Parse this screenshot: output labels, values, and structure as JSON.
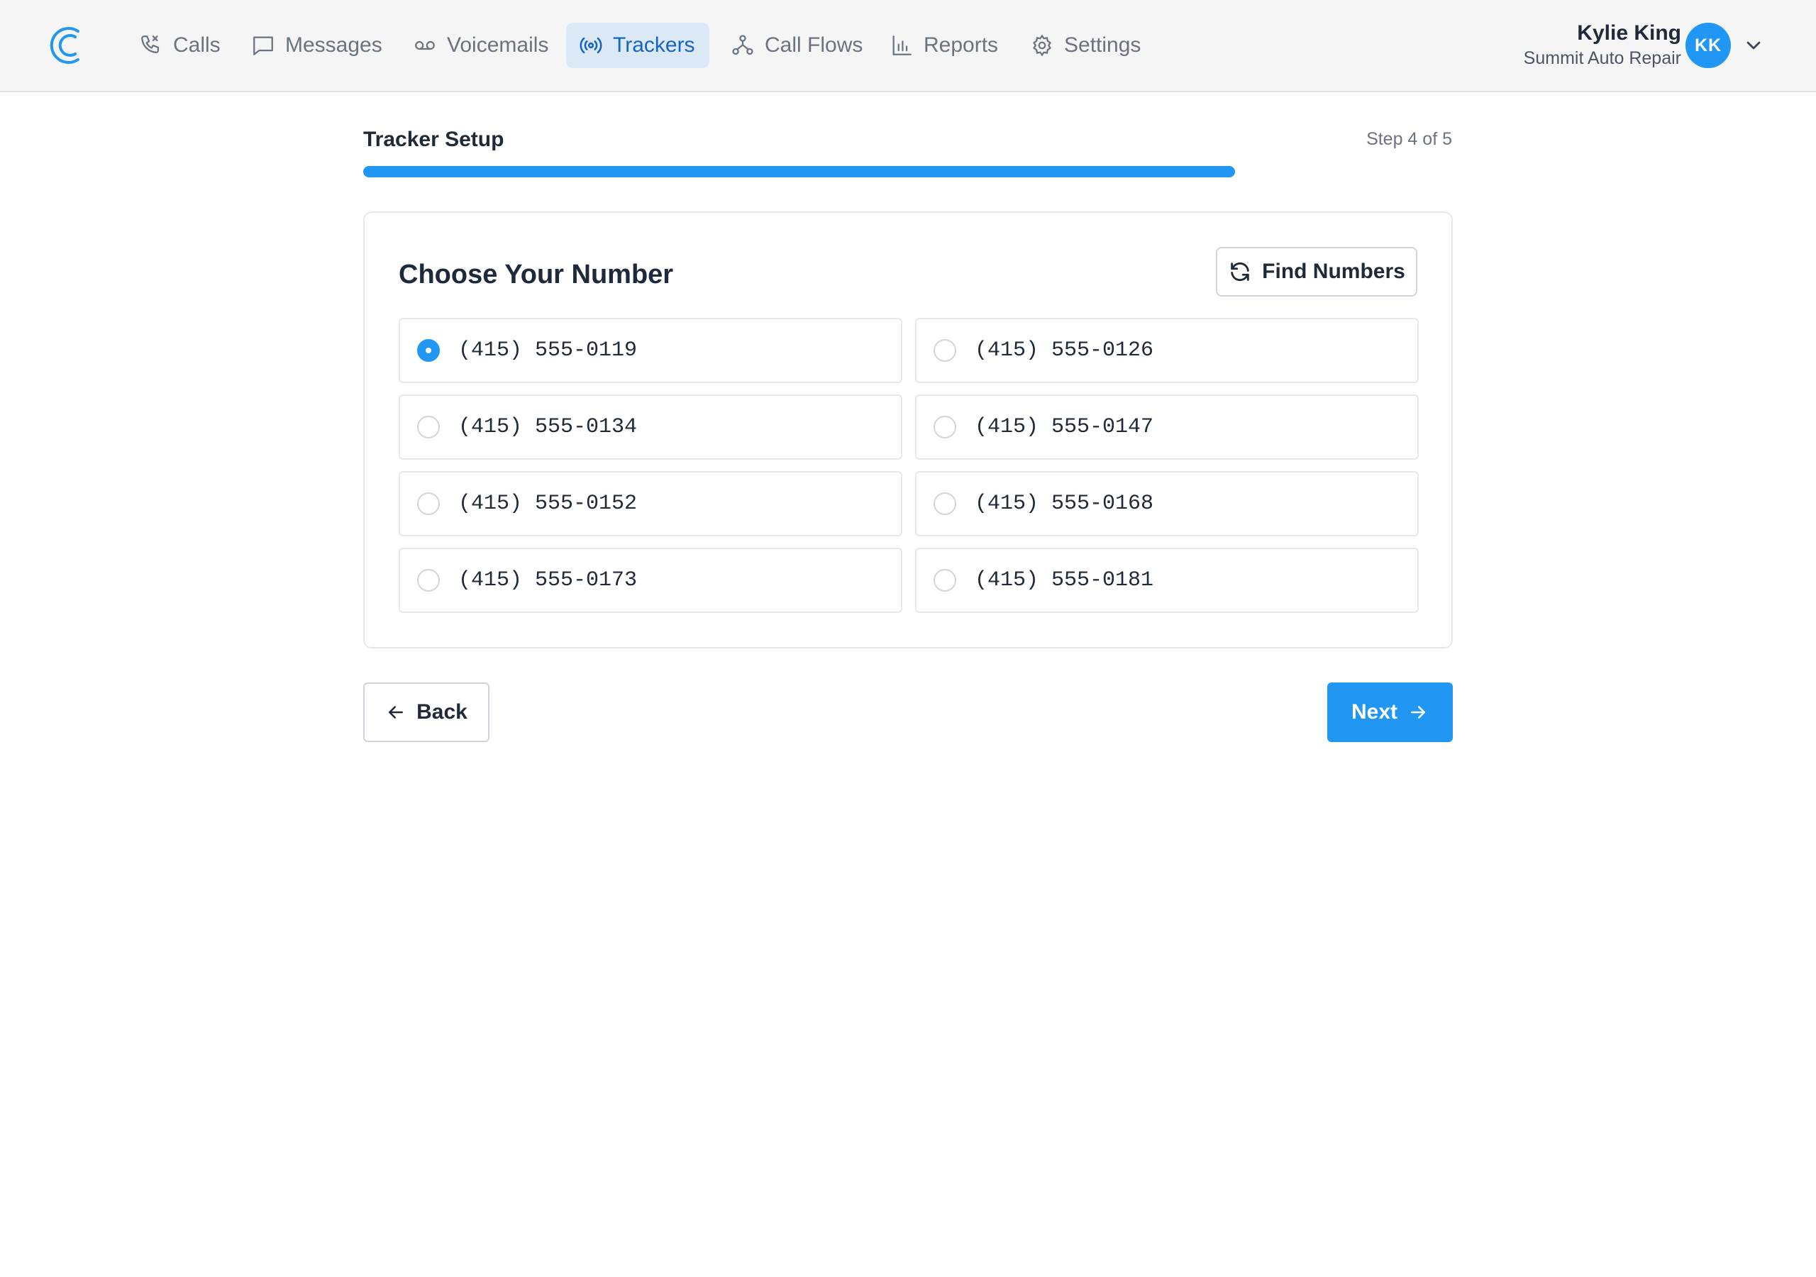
{
  "nav": {
    "logo_icon": "logo-icon",
    "items": [
      {
        "label": "Calls",
        "icon": "phone-icon",
        "active": false
      },
      {
        "label": "Messages",
        "icon": "message-icon",
        "active": false
      },
      {
        "label": "Voicemails",
        "icon": "voicemail-icon",
        "active": false
      },
      {
        "label": "Trackers",
        "icon": "broadcast-icon",
        "active": true
      },
      {
        "label": "Call Flows",
        "icon": "flow-icon",
        "active": false
      },
      {
        "label": "Reports",
        "icon": "bar-chart-icon",
        "active": false
      },
      {
        "label": "Settings",
        "icon": "gear-icon",
        "active": false
      }
    ]
  },
  "user": {
    "name": "Kylie King",
    "org": "Summit Auto Repair",
    "initials": "KK"
  },
  "setup": {
    "title": "Tracker Setup",
    "step": "Step 4 of 5",
    "progress": 0.8
  },
  "card": {
    "title": "Choose Your Number",
    "find_button": "Find Numbers",
    "numbers": [
      {
        "value": "(415) 555-0119",
        "selected": true
      },
      {
        "value": "(415) 555-0126",
        "selected": false
      },
      {
        "value": "(415) 555-0134",
        "selected": false
      },
      {
        "value": "(415) 555-0147",
        "selected": false
      },
      {
        "value": "(415) 555-0152",
        "selected": false
      },
      {
        "value": "(415) 555-0168",
        "selected": false
      },
      {
        "value": "(415) 555-0173",
        "selected": false
      },
      {
        "value": "(415) 555-0181",
        "selected": false
      }
    ]
  },
  "footer": {
    "back_label": "Back",
    "next_label": "Next"
  },
  "colors": {
    "accent": "#2196f3",
    "active_nav_bg": "#dbe9f7",
    "active_nav_text": "#1565c0"
  }
}
